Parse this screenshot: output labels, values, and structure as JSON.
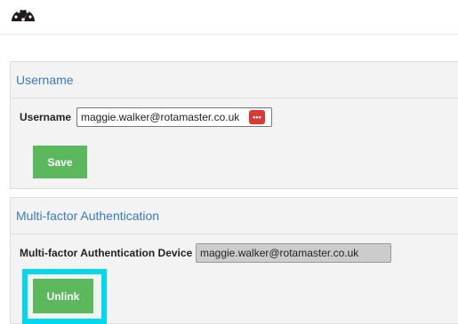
{
  "header": {
    "logo_icon": "dashboard-gauge-icon"
  },
  "username_section": {
    "title": "Username",
    "field_label": "Username",
    "field_value": "maggie.walker@rotamaster.co.uk",
    "password_manager_icon": "password-manager-icon",
    "save_label": "Save"
  },
  "mfa_section": {
    "title": "Multi-factor Authentication",
    "device_label": "Multi-factor Authentication Device",
    "device_value": "maggie.walker@rotamaster.co.uk",
    "unlink_label": "Unlink"
  },
  "colors": {
    "accent_blue": "#3a7bbf",
    "button_green": "#5cb85c",
    "highlight_cyan": "#00d8f0",
    "pm_red": "#d93b34"
  }
}
